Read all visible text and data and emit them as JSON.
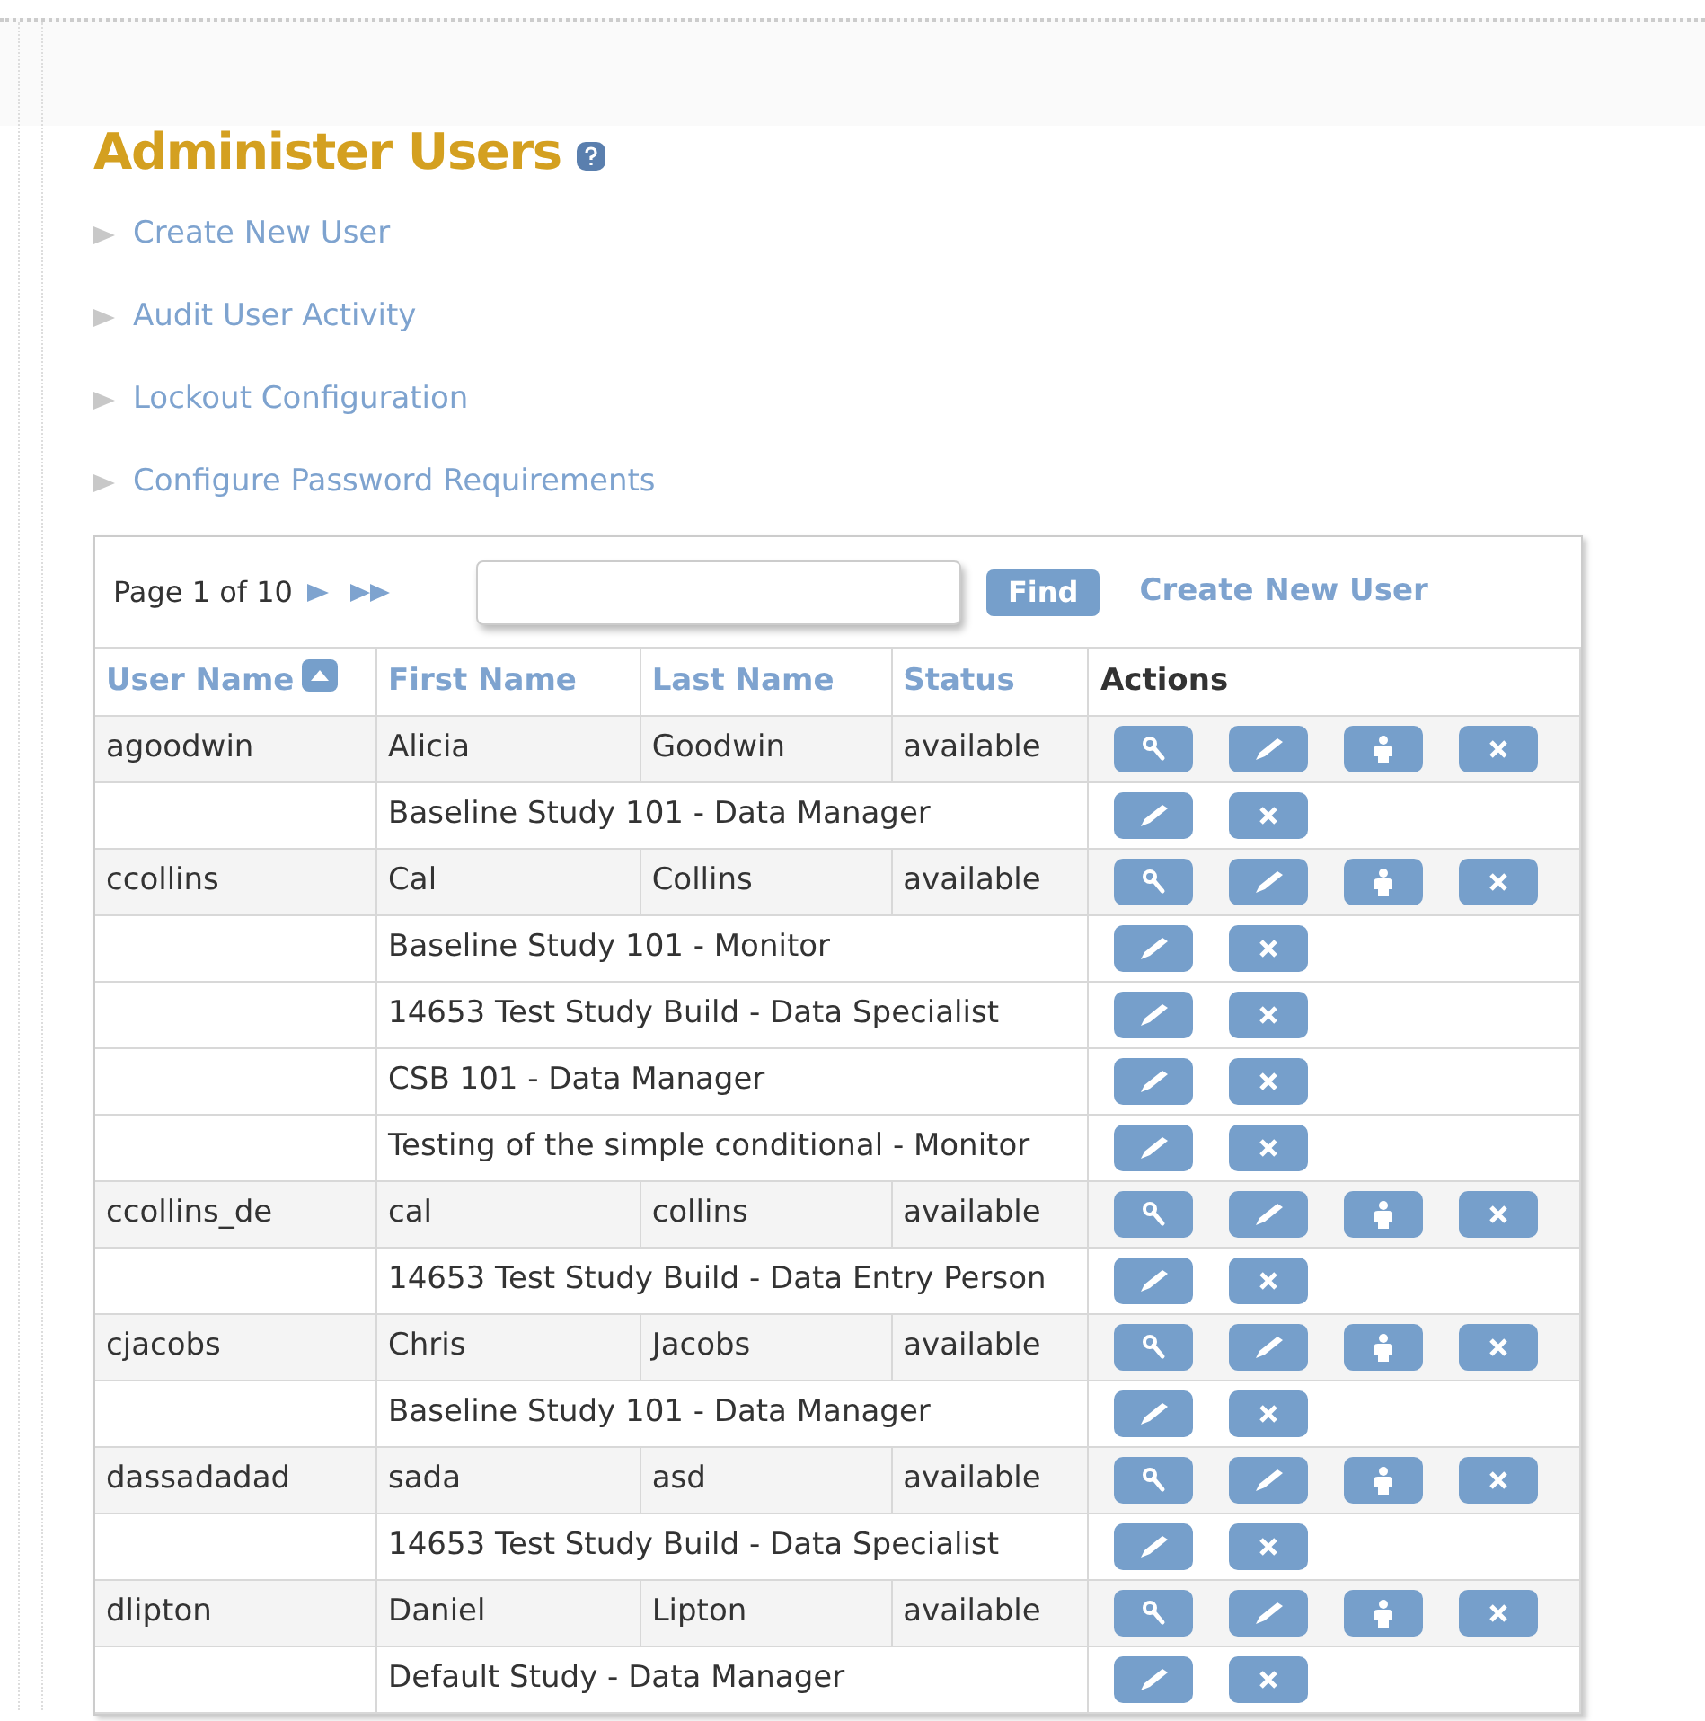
{
  "title": "Administer Users",
  "links": [
    "Create New User",
    "Audit User Activity",
    "Lockout Configuration",
    "Configure Password Requirements"
  ],
  "toolbar": {
    "page_label": "Page 1 of 10",
    "find_button": "Find",
    "create_link": "Create New User"
  },
  "table": {
    "columns": [
      {
        "label": "User Name",
        "sortable": true,
        "sorted": true
      },
      {
        "label": "First Name",
        "sortable": true,
        "sorted": false
      },
      {
        "label": "Last Name",
        "sortable": true,
        "sorted": false
      },
      {
        "label": "Status",
        "sortable": true,
        "sorted": false
      },
      {
        "label": "Actions",
        "sortable": false,
        "sorted": false
      }
    ],
    "rows": [
      {
        "kind": "user",
        "user_name": "agoodwin",
        "first_name": "Alicia",
        "last_name": "Goodwin",
        "status": "available"
      },
      {
        "kind": "role",
        "role": "Baseline Study 101 - Data Manager"
      },
      {
        "kind": "user",
        "user_name": "ccollins",
        "first_name": "Cal",
        "last_name": "Collins",
        "status": "available"
      },
      {
        "kind": "role",
        "role": "Baseline Study 101 - Monitor"
      },
      {
        "kind": "role",
        "role": "14653 Test Study Build - Data Specialist"
      },
      {
        "kind": "role",
        "role": "CSB 101 - Data Manager"
      },
      {
        "kind": "role",
        "role": "Testing of the simple conditional - Monitor"
      },
      {
        "kind": "user",
        "user_name": "ccollins_de",
        "first_name": "cal",
        "last_name": "collins",
        "status": "available"
      },
      {
        "kind": "role",
        "role": "14653 Test Study Build - Data Entry Person"
      },
      {
        "kind": "user",
        "user_name": "cjacobs",
        "first_name": "Chris",
        "last_name": "Jacobs",
        "status": "available"
      },
      {
        "kind": "role",
        "role": "Baseline Study 101 - Data Manager"
      },
      {
        "kind": "user",
        "user_name": "dassadadad",
        "first_name": "sada",
        "last_name": "asd",
        "status": "available"
      },
      {
        "kind": "role",
        "role": "14653 Test Study Build - Data Specialist"
      },
      {
        "kind": "user",
        "user_name": "dlipton",
        "first_name": "Daniel",
        "last_name": "Lipton",
        "status": "available"
      },
      {
        "kind": "role",
        "role": "Default Study - Data Manager"
      }
    ]
  }
}
